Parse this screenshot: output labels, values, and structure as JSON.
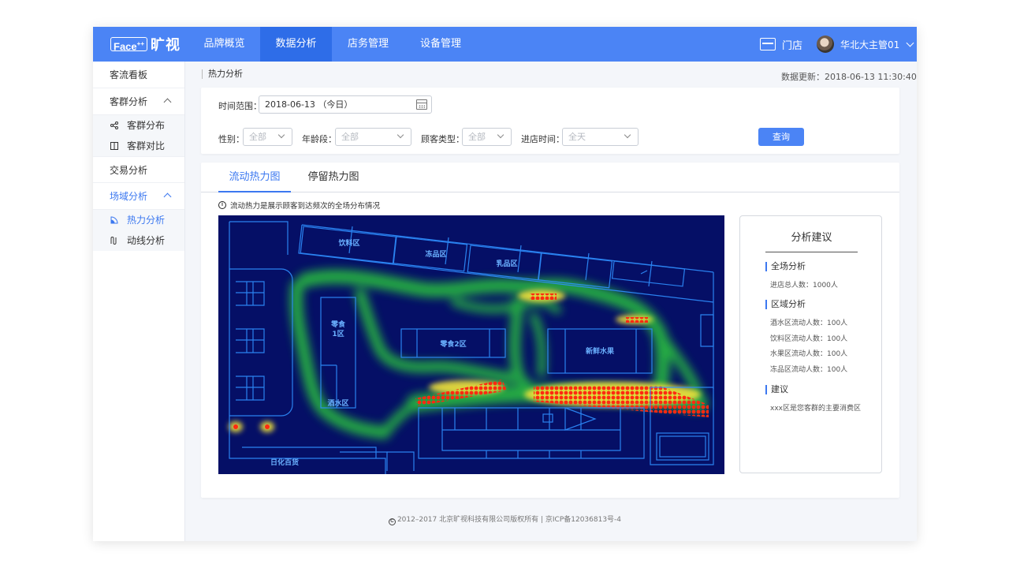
{
  "brand": {
    "logo_text": "Face",
    "logo_sup": "++",
    "logo_cn": "旷视"
  },
  "nav": {
    "items": [
      {
        "label": "品牌概览",
        "active": false
      },
      {
        "label": "数据分析",
        "active": true
      },
      {
        "label": "店务管理",
        "active": false
      },
      {
        "label": "设备管理",
        "active": false
      }
    ],
    "store_label": "门店",
    "user_name": "华北大主管01"
  },
  "sidebar": {
    "item_flow": "客流看板",
    "group_customer": "客群分析",
    "sub_distribution": "客群分布",
    "sub_compare": "客群对比",
    "item_trade": "交易分析",
    "group_venue": "场域分析",
    "sub_heat": "热力分析",
    "sub_path": "动线分析"
  },
  "breadcrumb": "热力分析",
  "update_time": "数据更新：2018-06-13 11:30:40",
  "filters": {
    "time_label": "时间范围：",
    "time_value": "2018-06-13 （今日）",
    "gender_label": "性别：",
    "gender_value": "全部",
    "age_label": "年龄段：",
    "age_value": "全部",
    "customer_type_label": "顾客类型：",
    "customer_type_value": "全部",
    "entry_time_label": "进店时间：",
    "entry_time_value": "全天",
    "query_button": "查询"
  },
  "tabs": [
    {
      "label": "流动热力图",
      "active": true
    },
    {
      "label": "停留热力图",
      "active": false
    }
  ],
  "hint": "流动热力是展示顾客到达频次的全场分布情况",
  "map_zones": {
    "drinks": "饮料区",
    "frozen": "冻品区",
    "dairy": "乳品区",
    "snack1": "零食\n1区",
    "snack2": "零食2区",
    "fresh": "新鲜水果",
    "wine": "酒水区",
    "daily": "日化百货"
  },
  "advice": {
    "title": "分析建议",
    "overall_heading": "全场分析",
    "overall_text": "进店总人数：1000人",
    "zone_heading": "区域分析",
    "zone_lines": [
      "酒水区流动人数：100人",
      "饮料区流动人数：100人",
      "水果区流动人数：100人",
      "冻品区流动人数：100人"
    ],
    "suggest_heading": "建议",
    "suggest_text": "xxx区是您客群的主要消费区"
  },
  "footer": "2012–2017 北京旷视科技有限公司版权所有 | 京ICP备12036813号-4",
  "colors": {
    "primary": "#4b84f5",
    "nav_active": "#2e6de8",
    "heat_bg": "#050f66",
    "line": "#2f8fff"
  }
}
